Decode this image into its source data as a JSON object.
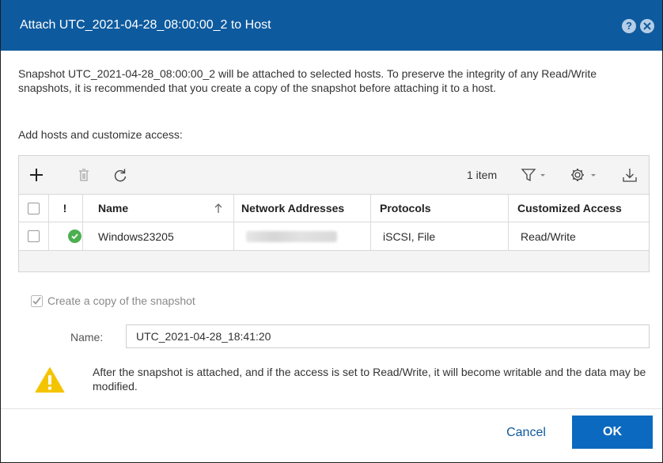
{
  "window": {
    "title": "Attach UTC_2021-04-28_08:00:00_2 to Host",
    "help_glyph": "?",
    "help_icon": "question-circle-icon",
    "close_icon": "close-circle-icon"
  },
  "intro_text": "Snapshot UTC_2021-04-28_08:00:00_2 will be attached to selected hosts. To preserve the integrity of any Read/Write snapshots, it is recommended that you create a copy of the snapshot before attaching it to a host.",
  "section_label": "Add hosts and customize access:",
  "toolbar": {
    "item_count": "1 item",
    "icons": [
      "add-icon",
      "trash-icon",
      "refresh-icon",
      "filter-icon",
      "gear-icon",
      "download-icon"
    ]
  },
  "table": {
    "columns": {
      "status": "!",
      "name": "Name",
      "network_addresses": "Network Addresses",
      "protocols": "Protocols",
      "customized_access": "Customized Access"
    },
    "rows": [
      {
        "status": "ok",
        "name": "Windows23205",
        "network_addresses": "",
        "protocols": "iSCSI, File",
        "customized_access": "Read/Write"
      }
    ]
  },
  "copy_option": {
    "label": "Create a copy of the snapshot",
    "checked": true,
    "disabled": true
  },
  "name_field": {
    "label": "Name:",
    "value": "UTC_2021-04-28_18:41:20"
  },
  "warning": {
    "icon": "warning-icon",
    "text": "After the snapshot is attached, and if the access is set to Read/Write, it will become writable and the data may be modified."
  },
  "buttons": {
    "cancel": "Cancel",
    "ok": "OK"
  },
  "colors": {
    "titlebar": "#0d5a9e",
    "primary": "#0b6abf",
    "success": "#4caf50",
    "warning": "#f5c400"
  }
}
